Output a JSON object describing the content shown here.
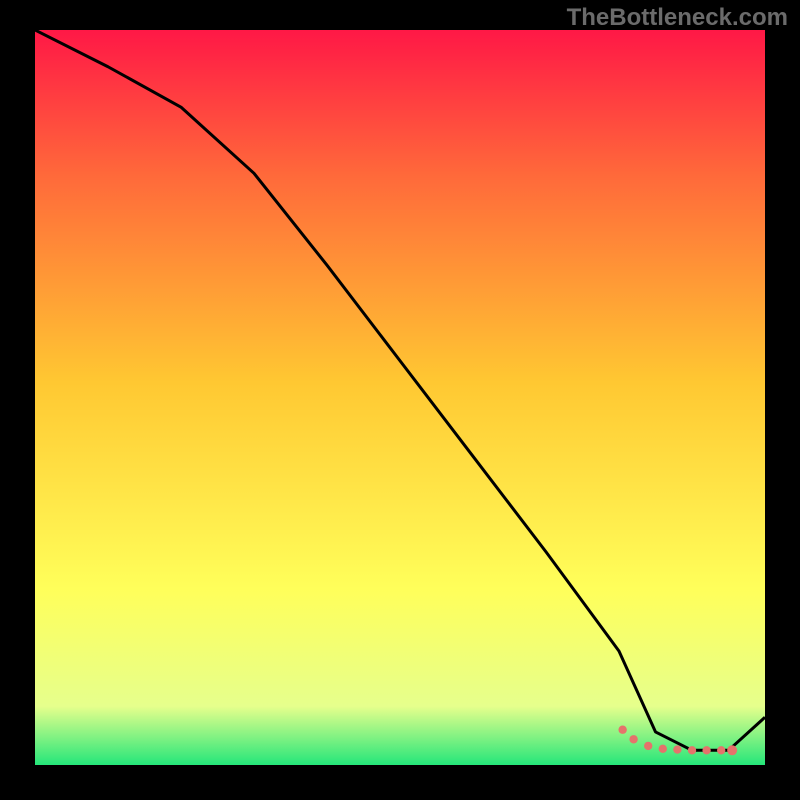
{
  "watermark": "TheBottleneck.com",
  "chart_data": {
    "type": "line",
    "title": "",
    "xlabel": "",
    "ylabel": "",
    "xlim": [
      0,
      100
    ],
    "ylim": [
      0,
      100
    ],
    "grid": false,
    "legend": false,
    "background_gradient": {
      "top": "#ff1846",
      "upper_mid": "#ff6a3a",
      "mid": "#ffc832",
      "lower_mid": "#ffff5a",
      "near_bottom": "#e6ff8c",
      "bottom": "#25e67a"
    },
    "series": [
      {
        "name": "curve",
        "color": "#000000",
        "x": [
          0,
          10,
          20,
          30,
          40,
          50,
          60,
          70,
          80,
          85,
          90,
          95,
          100
        ],
        "y": [
          100,
          95,
          89.5,
          80.5,
          68,
          55,
          42,
          29,
          15.5,
          4.5,
          2,
          2,
          6.5
        ]
      }
    ],
    "markers": [
      {
        "name": "dotted-segment",
        "color": "#e5736b",
        "style": "dotted",
        "x": [
          80.5,
          82,
          84,
          86,
          88,
          90,
          92,
          94,
          95.5
        ],
        "y": [
          4.8,
          3.5,
          2.6,
          2.2,
          2.1,
          2,
          2,
          2,
          2
        ]
      },
      {
        "name": "end-dot",
        "color": "#e5736b",
        "x": 95.5,
        "y": 2,
        "r": 5
      }
    ]
  }
}
